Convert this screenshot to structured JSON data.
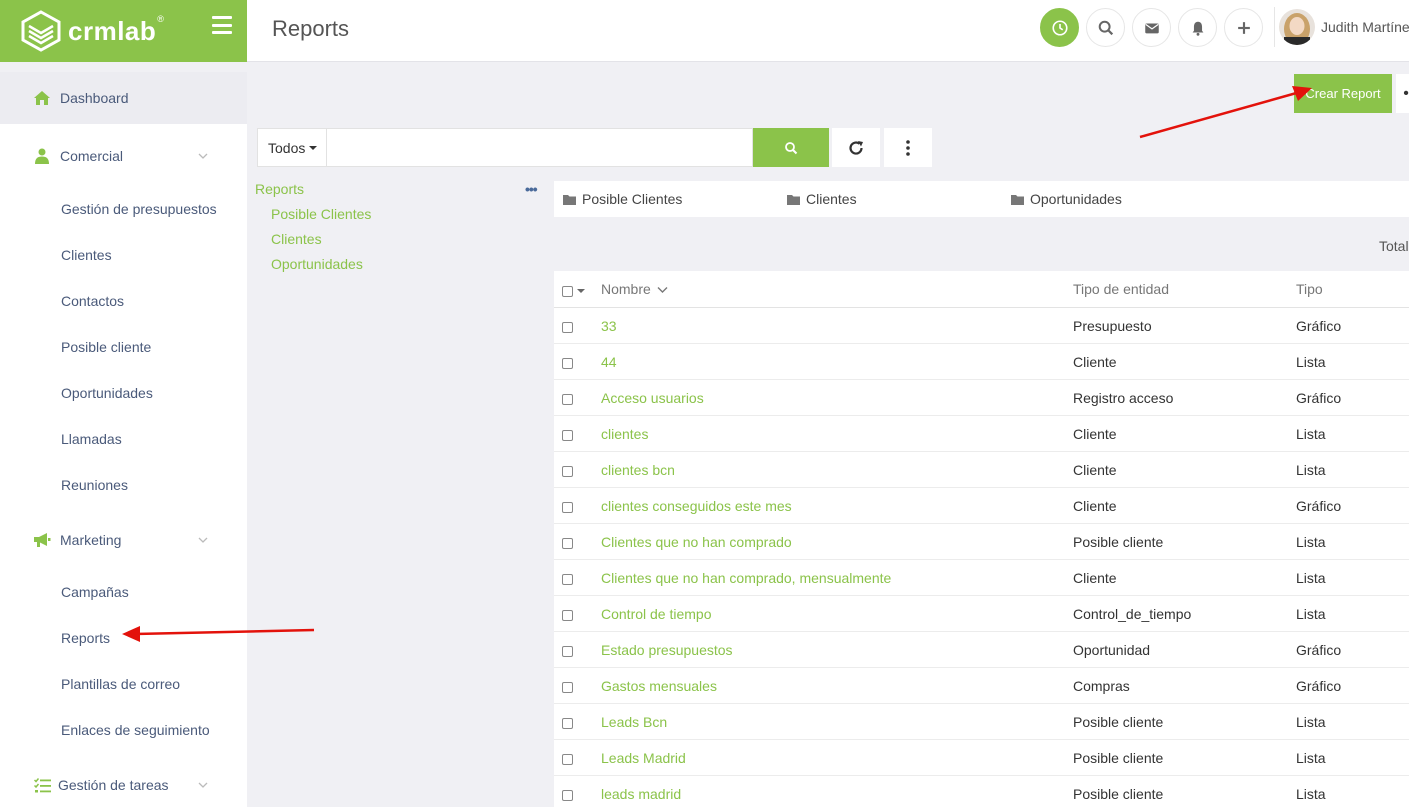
{
  "brand": {
    "name": "crmlab",
    "reg": "®",
    "accent": "#8bc34a"
  },
  "header": {
    "title": "Reports",
    "icons": [
      "clock-icon",
      "search-icon",
      "mail-icon",
      "bell-icon",
      "plus-icon"
    ],
    "user": {
      "name": "Judith Martínez"
    }
  },
  "sidebar": {
    "dashboard": "Dashboard",
    "comercial": {
      "label": "Comercial",
      "items": [
        "Gestión de presupuestos",
        "Clientes",
        "Contactos",
        "Posible cliente",
        "Oportunidades",
        "Llamadas",
        "Reuniones"
      ]
    },
    "marketing": {
      "label": "Marketing",
      "items": [
        "Campañas",
        "Reports",
        "Plantillas de correo",
        "Enlaces de seguimiento"
      ]
    },
    "tareas": "Gestión de tareas"
  },
  "toolbar": {
    "create_label": "Crear Report",
    "filter_label": "Todos",
    "search_placeholder": ""
  },
  "tree": {
    "root": "Reports",
    "children": [
      "Posible Clientes",
      "Clientes",
      "Oportunidades"
    ]
  },
  "folders": [
    "Posible Clientes",
    "Clientes",
    "Oportunidades"
  ],
  "total_label": "Total",
  "table": {
    "headers": {
      "name": "Nombre",
      "entity": "Tipo de entidad",
      "type": "Tipo"
    },
    "rows": [
      {
        "name": "33",
        "entity": "Presupuesto",
        "type": "Gráfico"
      },
      {
        "name": "44",
        "entity": "Cliente",
        "type": "Lista"
      },
      {
        "name": "Acceso usuarios",
        "entity": "Registro acceso",
        "type": "Gráfico"
      },
      {
        "name": "clientes",
        "entity": "Cliente",
        "type": "Lista"
      },
      {
        "name": "clientes bcn",
        "entity": "Cliente",
        "type": "Lista"
      },
      {
        "name": "clientes conseguidos este mes",
        "entity": "Cliente",
        "type": "Gráfico"
      },
      {
        "name": "Clientes que no han comprado",
        "entity": "Posible cliente",
        "type": "Lista"
      },
      {
        "name": "Clientes que no han comprado, mensualmente",
        "entity": "Cliente",
        "type": "Lista"
      },
      {
        "name": "Control de tiempo",
        "entity": "Control_de_tiempo",
        "type": "Lista"
      },
      {
        "name": "Estado presupuestos",
        "entity": "Oportunidad",
        "type": "Gráfico"
      },
      {
        "name": "Gastos mensuales",
        "entity": "Compras",
        "type": "Gráfico"
      },
      {
        "name": "Leads Bcn",
        "entity": "Posible cliente",
        "type": "Lista"
      },
      {
        "name": "Leads Madrid",
        "entity": "Posible cliente",
        "type": "Lista"
      },
      {
        "name": "leads madrid",
        "entity": "Posible cliente",
        "type": "Lista"
      }
    ]
  }
}
